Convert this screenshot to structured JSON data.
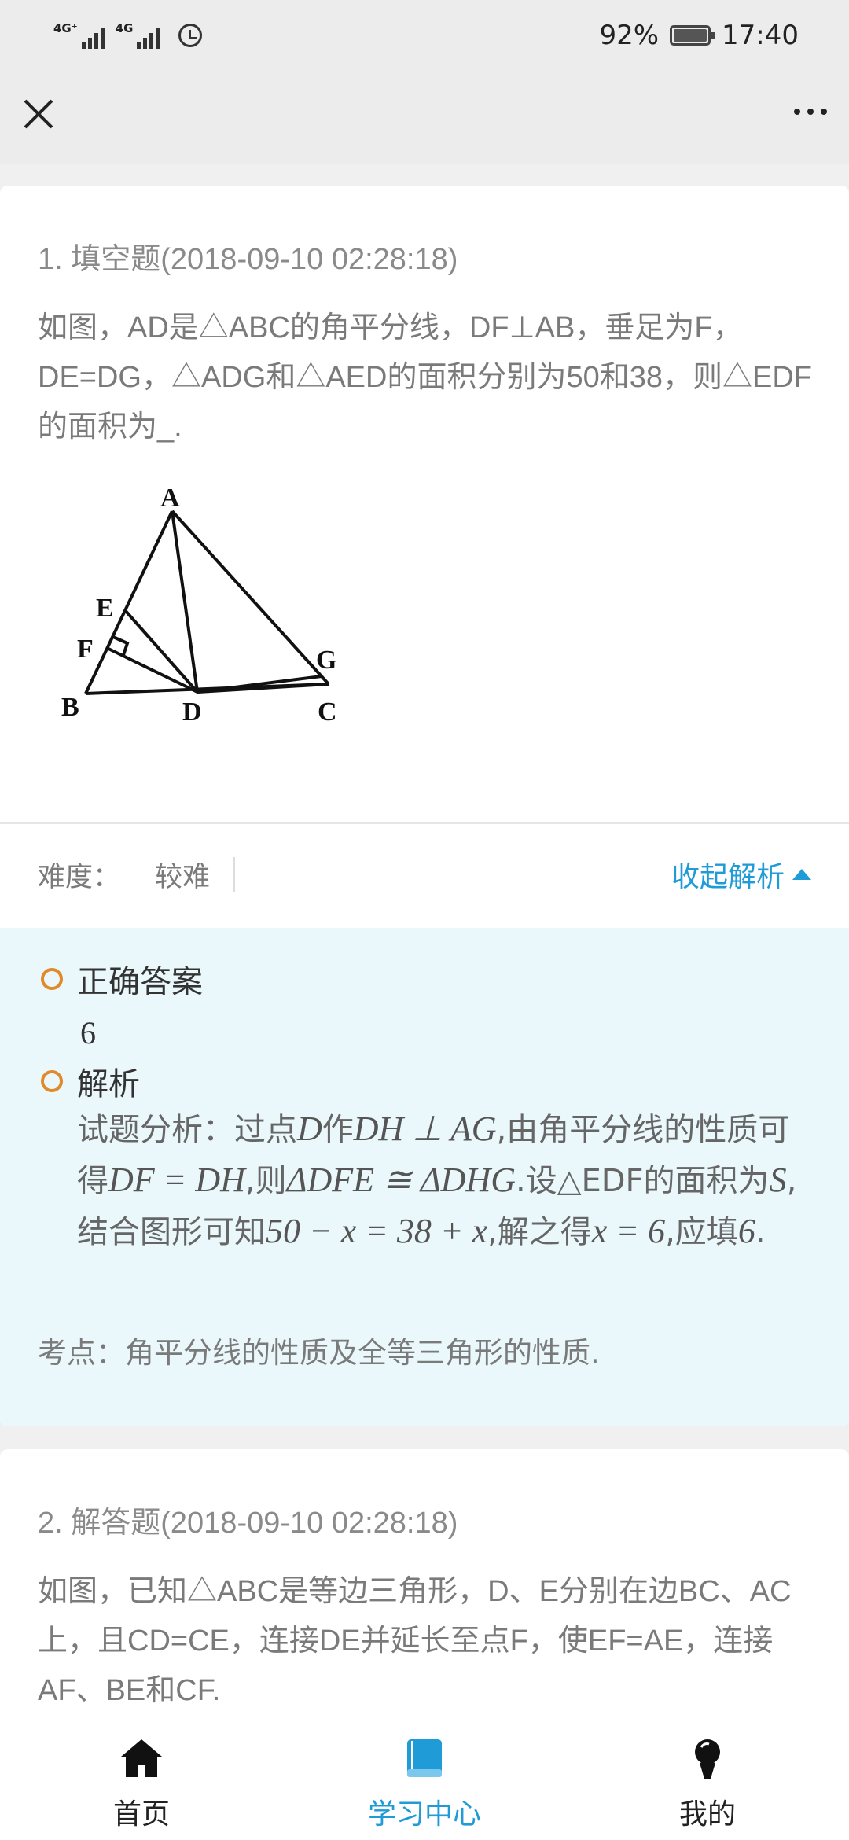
{
  "status_bar": {
    "signal1_label": "4G⁺",
    "signal2_label": "4G",
    "battery": "92%",
    "time": "17:40"
  },
  "questions": [
    {
      "header": "1. 填空题(2018-09-10 02:28:18)",
      "text": "如图，AD是△ABC的角平分线，DF⊥AB，垂足为F，DE=DG，△ADG和△AED的面积分别为50和38，则△EDF的面积为_.",
      "figure_labels": [
        "A",
        "E",
        "F",
        "G",
        "B",
        "D",
        "C"
      ],
      "difficulty_label": "难度：",
      "difficulty_value": "较难",
      "toggle_label": "收起解析",
      "answer_title": "正确答案",
      "answer_value": "6",
      "analysis_title": "解析",
      "analysis": {
        "p1": "试题分析：过点",
        "m1": "D",
        "p2": "作",
        "m2": "DH ⊥ AG",
        "p3": ",由角平分线的性质可得",
        "m3": "DF = DH",
        "p4": ",则",
        "m4": "ΔDFE ≅ ΔDHG",
        "p5": ".设△EDF的面积为",
        "m5": "S",
        "p6": ",结合图形可知",
        "m6": "50 − x = 38 + x",
        "p7": ",解之得",
        "m7": "x = 6",
        "p8": ",应填",
        "m8": "6",
        "p9": "."
      },
      "kaodian": "考点：角平分线的性质及全等三角形的性质."
    },
    {
      "header": "2. 解答题(2018-09-10 02:28:18)",
      "text": "如图，已知△ABC是等边三角形，D、E分别在边BC、AC上，且CD=CE，连接DE并延长至点F，使EF=AE，连接AF、BE和CF."
    }
  ],
  "tabs": [
    {
      "label": "首页",
      "icon": "home-icon",
      "active": false
    },
    {
      "label": "学习中心",
      "icon": "book-icon",
      "active": true
    },
    {
      "label": "我的",
      "icon": "profile-icon",
      "active": false
    }
  ],
  "colors": {
    "accent": "#1f9bd7",
    "bullet": "#e08a2c",
    "analysis_bg": "#eaf8fb"
  }
}
